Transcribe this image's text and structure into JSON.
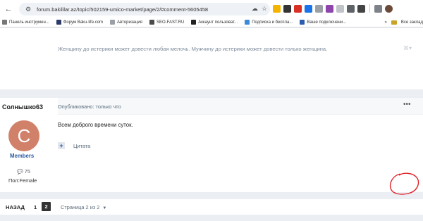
{
  "browser": {
    "url": "forum.bakililar.az/topic/502159-umico-market/page/2/#comment-5605458"
  },
  "bookmarks": {
    "items": [
      {
        "label": "Панель инструмен...",
        "color": "#777777"
      },
      {
        "label": "Форум Baku-life.com",
        "color": "#2b3a67"
      },
      {
        "label": "Авторизация",
        "color": "#9aa0a6"
      },
      {
        "label": "SEO-FAST.RU",
        "color": "#4a4a4a"
      },
      {
        "label": "Аккаунт пользоват...",
        "color": "#222222"
      },
      {
        "label": "Подписка и беспла...",
        "color": "#3b8bd6"
      },
      {
        "label": "Ваше подключени...",
        "color": "#2a5db0"
      }
    ],
    "more_label": "»",
    "all_label": "Все заклад"
  },
  "signature": {
    "text": "Женщину до истерики может довести любая мелочь. Мужчину до истерики может довести только женщина."
  },
  "post": {
    "author": "Солнышко63",
    "posted": "Опубликовано: только что",
    "avatar_letter": "C",
    "group": "Members",
    "reputation": "75",
    "gender": "Пол:Female",
    "text": "Всем доброго времени суток.",
    "quote_label": "Цитата"
  },
  "pagination": {
    "back": "НАЗАД",
    "page1": "1",
    "page2": "2",
    "page_of": "Страница 2 из 2"
  },
  "colors": {
    "group": "#2c5aa0",
    "avatar_bg": "#d1816a",
    "scribble": "#e0242b"
  }
}
